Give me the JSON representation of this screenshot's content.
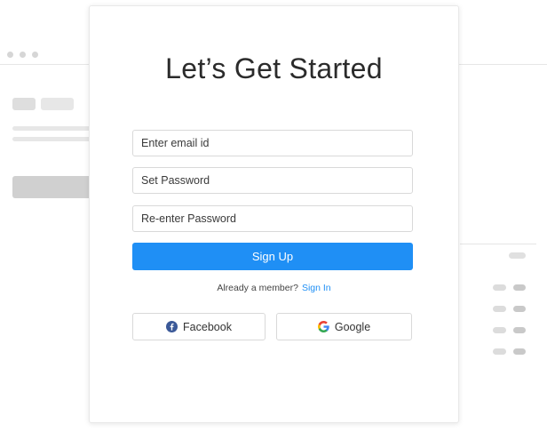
{
  "modal": {
    "title": "Let’s Get Started",
    "email_placeholder": "Enter email id",
    "password_placeholder": "Set Password",
    "repassword_placeholder": "Re-enter Password",
    "signup_label": "Sign Up",
    "already_text": "Already a member?",
    "signin_label": "Sign In",
    "facebook_label": "Facebook",
    "google_label": "Google"
  },
  "colors": {
    "accent": "#1f8ff5",
    "facebook": "#3b5998"
  },
  "icons": {
    "facebook": "facebook-icon",
    "google": "google-icon"
  }
}
